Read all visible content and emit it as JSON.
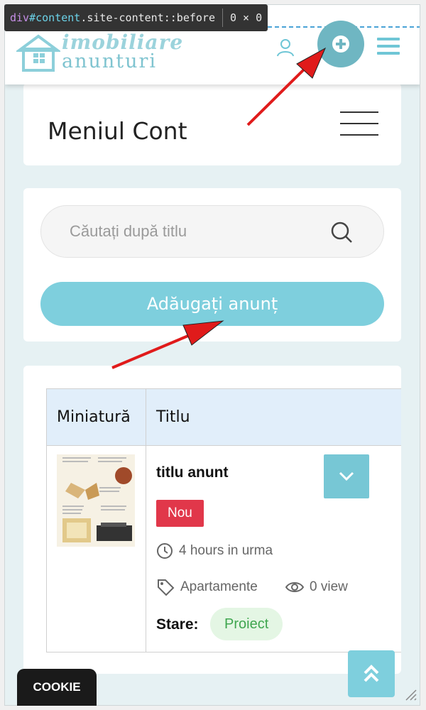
{
  "devtools": {
    "tag": "div",
    "id": "#content",
    "cls": ".site-content::before",
    "size": "0 × 0"
  },
  "header": {
    "logo_top": "imobiliare",
    "logo_bottom": "anunturi",
    "user_icon": "user-icon",
    "add_icon": "plus-circle-icon",
    "menu_icon": "hamburger-icon"
  },
  "account_menu": {
    "title": "Meniul Cont"
  },
  "search": {
    "placeholder": "Căutați după titlu",
    "add_button": "Adăugați anunț"
  },
  "table": {
    "headers": [
      "Miniatură",
      "Titlu"
    ],
    "rows": [
      {
        "title": "titlu anunt",
        "badge": "Nou",
        "time": "4 hours in urma",
        "category": "Apartamente",
        "views": "0 view",
        "status_label": "Stare:",
        "status": "Proiect"
      }
    ]
  },
  "cookie": {
    "label": "COOKIE"
  },
  "colors": {
    "accent": "#7ecfdd",
    "badge_new": "#e1374a",
    "status_bg": "#e4f6e4",
    "status_text": "#3fa64f",
    "arrow": "#e01b1b"
  }
}
